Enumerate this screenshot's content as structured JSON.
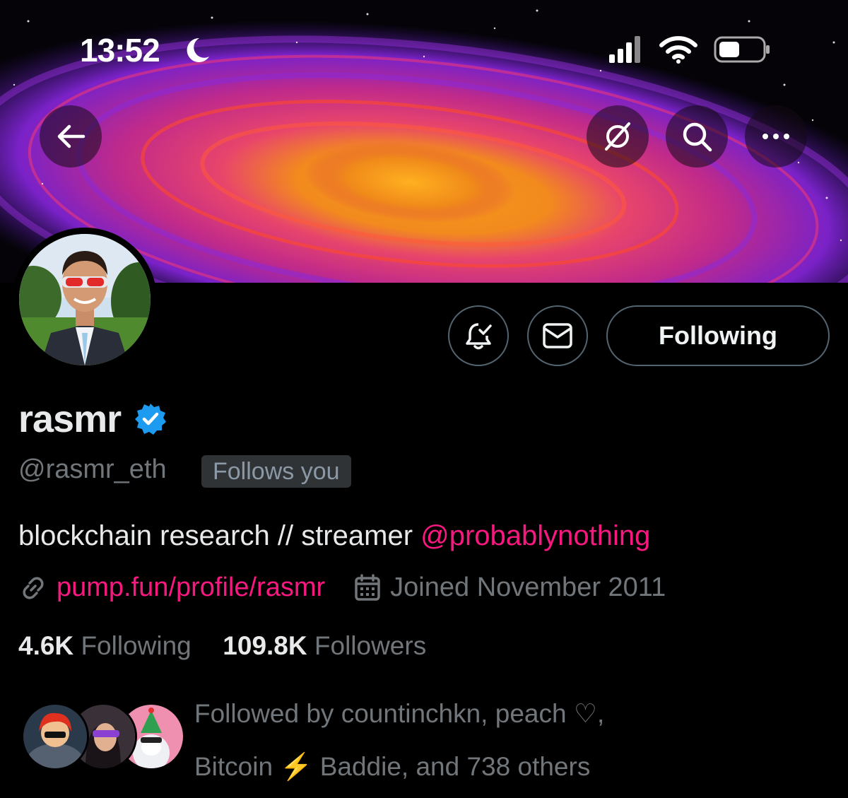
{
  "status_bar": {
    "time": "13:52"
  },
  "profile": {
    "display_name": "rasmr",
    "handle": "@rasmr_eth",
    "follows_you_badge": "Follows you",
    "following_button": "Following",
    "bio_text": "blockchain research // streamer ",
    "bio_mention": "@probablynothing",
    "website": "pump.fun/profile/rasmr",
    "joined": "Joined November 2011",
    "following_count": "4.6K",
    "following_label": "Following",
    "followers_count": "109.8K",
    "followers_label": "Followers",
    "followed_by_line1": "Followed by countinchkn, peach ♡,",
    "followed_by_line2_a": "Bitcoin ",
    "followed_by_emoji": "⚡",
    "followed_by_line2_b": " Baddie, and 738 others"
  },
  "icons": [
    "back-arrow-icon",
    "grok-icon",
    "search-icon",
    "more-icon",
    "notification-bell-icon",
    "mail-icon",
    "verified-badge-icon",
    "link-icon",
    "calendar-icon"
  ],
  "colors": {
    "accent_pink": "#f91880",
    "verified_blue": "#1d9bf0",
    "muted": "#71767b"
  }
}
